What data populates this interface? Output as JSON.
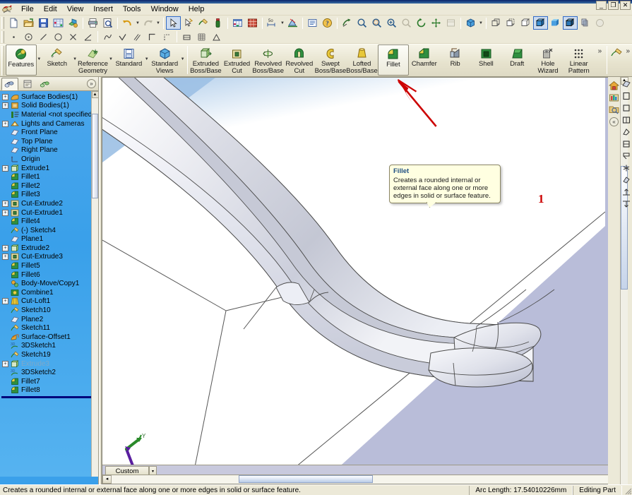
{
  "app": {
    "title": "SolidWorks",
    "logo_icon": "solidworks-logo-icon",
    "minimize_label": "_",
    "restore_label": "❐",
    "close_label": "✕"
  },
  "menubar": {
    "items": [
      {
        "label": "File",
        "name": "menu-file"
      },
      {
        "label": "Edit",
        "name": "menu-edit"
      },
      {
        "label": "View",
        "name": "menu-view"
      },
      {
        "label": "Insert",
        "name": "menu-insert"
      },
      {
        "label": "Tools",
        "name": "menu-tools"
      },
      {
        "label": "Window",
        "name": "menu-window"
      },
      {
        "label": "Help",
        "name": "menu-help"
      }
    ]
  },
  "standard_toolbar": {
    "groups": [
      {
        "buttons": [
          {
            "icon": "new-document-icon",
            "label": "New"
          },
          {
            "icon": "open-folder-icon",
            "label": "Open"
          },
          {
            "icon": "save-icon",
            "label": "Save"
          },
          {
            "icon": "print-preview-grid-icon",
            "label": "Make Drawing from Part"
          },
          {
            "icon": "assembly-icon",
            "label": "Make Assembly from Part"
          }
        ]
      },
      {
        "buttons": [
          {
            "icon": "print-icon",
            "label": "Print"
          },
          {
            "icon": "print-preview-icon",
            "label": "Print Preview"
          }
        ]
      },
      {
        "buttons": [
          {
            "icon": "undo-icon",
            "label": "Undo",
            "dropdown": true
          },
          {
            "icon": "redo-icon",
            "label": "Redo",
            "dropdown": true,
            "disabled": true
          }
        ]
      },
      {
        "buttons": [
          {
            "icon": "select-arrow-icon",
            "label": "Select",
            "framed": true
          },
          {
            "icon": "rebuild-icon",
            "label": "Rebuild"
          },
          {
            "icon": "edit-sketch-icon",
            "label": "Edit Sketch"
          },
          {
            "icon": "toolbox-icon",
            "label": "Toolbox"
          }
        ]
      },
      {
        "buttons": [
          {
            "icon": "options-grid-icon",
            "label": "Options"
          },
          {
            "icon": "red-grid-icon",
            "label": "Customize"
          }
        ]
      },
      {
        "buttons": [
          {
            "icon": "measure-icon",
            "label": "Measure",
            "dropdown": true
          },
          {
            "icon": "section-icon",
            "label": "Section View"
          }
        ]
      },
      {
        "buttons": [
          {
            "icon": "properties-icon",
            "label": "Properties"
          },
          {
            "icon": "help-icon",
            "label": "Help"
          }
        ]
      },
      {
        "buttons": [
          {
            "icon": "previous-view-icon",
            "label": "Previous View"
          },
          {
            "icon": "zoom-to-fit-icon",
            "label": "Zoom to Fit"
          },
          {
            "icon": "zoom-to-area-icon",
            "label": "Zoom to Area"
          },
          {
            "icon": "zoom-in-out-icon",
            "label": "Zoom In/Out"
          },
          {
            "icon": "zoom-to-selection-icon",
            "label": "Zoom to Selection",
            "disabled": true
          },
          {
            "icon": "rotate-view-icon",
            "label": "Rotate View"
          },
          {
            "icon": "pan-icon",
            "label": "Pan"
          },
          {
            "icon": "three-d-drawing-icon",
            "label": "3D Drawing View",
            "disabled": true
          }
        ]
      },
      {
        "buttons": [
          {
            "icon": "view-orientation-icon",
            "label": "View Orientation",
            "dropdown": true
          }
        ]
      },
      {
        "buttons": [
          {
            "icon": "wireframe-icon",
            "label": "Wireframe"
          },
          {
            "icon": "hidden-lines-visible-icon",
            "label": "Hidden Lines Visible"
          },
          {
            "icon": "hidden-lines-removed-icon",
            "label": "Hidden Lines Removed"
          },
          {
            "icon": "shaded-with-edges-icon",
            "label": "Shaded With Edges",
            "framed": true
          },
          {
            "icon": "shaded-icon",
            "label": "Shaded"
          },
          {
            "icon": "display-style-icon",
            "label": "Display Style",
            "framed": true
          },
          {
            "icon": "shadows-icon",
            "label": "Shadows In Shaded Mode"
          },
          {
            "icon": "realview-icon",
            "label": "RealView Graphics",
            "disabled": true
          }
        ]
      }
    ]
  },
  "sketch_toolbar": {
    "buttons": [
      {
        "icon": "point-icon",
        "label": "Point"
      },
      {
        "icon": "circle-icon",
        "label": "Circle"
      },
      {
        "icon": "line-icon",
        "label": "Line"
      },
      {
        "icon": "perimeter-circle-icon",
        "label": "Perimeter Circle"
      },
      {
        "icon": "trim-icon",
        "label": "Trim Entities"
      },
      {
        "icon": "angle-icon",
        "label": "Angle"
      },
      {
        "icon": "spline-icon",
        "label": "Spline"
      },
      {
        "icon": "check-icon",
        "label": "Display/Delete Relations"
      },
      {
        "icon": "offset-entities-icon",
        "label": "Offset Entities"
      },
      {
        "icon": "corner-rectangle-icon",
        "label": "Corner Rectangle"
      },
      {
        "icon": "construction-geometry-icon",
        "label": "Construction Geometry"
      },
      {
        "icon": "rectangular-pattern-icon",
        "label": "Linear Sketch Pattern"
      },
      {
        "icon": "grid-icon",
        "label": "Grid"
      },
      {
        "icon": "mirror-icon",
        "label": "Mirror Entities"
      }
    ]
  },
  "command_manager": {
    "tab_groups": [
      {
        "label": "Features",
        "icon": "features-icon",
        "selected": true,
        "dropdown": true
      },
      {
        "label": "Sketch",
        "icon": "sketch-icon",
        "selected": false,
        "dropdown": true
      },
      {
        "label": "Reference\nGeometry",
        "line1": "Reference",
        "line2": "Geometry",
        "icon": "reference-geometry-icon",
        "dropdown": true
      },
      {
        "label": "Standard",
        "line1": "Standard",
        "line2": "",
        "icon": "standard-icon",
        "dropdown": true
      },
      {
        "label": "Standard Views",
        "line1": "Standard",
        "line2": "Views",
        "icon": "standard-views-icon",
        "dropdown": true
      }
    ],
    "feature_buttons": [
      {
        "line1": "Extruded",
        "line2": "Boss/Base",
        "icon": "extruded-boss-base-icon",
        "selected": false
      },
      {
        "line1": "Extruded",
        "line2": "Cut",
        "icon": "extruded-cut-icon",
        "selected": false
      },
      {
        "line1": "Revolved",
        "line2": "Boss/Base",
        "icon": "revolved-boss-base-icon",
        "selected": false
      },
      {
        "line1": "Revolved",
        "line2": "Cut",
        "icon": "revolved-cut-icon",
        "selected": false
      },
      {
        "line1": "Swept",
        "line2": "Boss/Base",
        "icon": "swept-boss-base-icon",
        "selected": false
      },
      {
        "line1": "Lofted",
        "line2": "Boss/Base",
        "icon": "lofted-boss-base-icon",
        "selected": false
      },
      {
        "line1": "Fillet",
        "line2": "",
        "icon": "fillet-icon",
        "selected": true
      },
      {
        "line1": "Chamfer",
        "line2": "",
        "icon": "chamfer-icon",
        "selected": false
      },
      {
        "line1": "Rib",
        "line2": "",
        "icon": "rib-icon",
        "selected": false
      },
      {
        "line1": "Shell",
        "line2": "",
        "icon": "shell-icon",
        "selected": false
      },
      {
        "line1": "Draft",
        "line2": "",
        "icon": "draft-icon",
        "selected": false
      },
      {
        "line1": "Hole",
        "line2": "Wizard",
        "icon": "hole-wizard-icon",
        "selected": false
      },
      {
        "line1": "Linear",
        "line2": "Pattern",
        "icon": "linear-pattern-icon",
        "selected": false
      }
    ],
    "overflow_label": "»",
    "overflow_label2": "»"
  },
  "tooltip": {
    "title": "Fillet",
    "body": "Creates a rounded internal or external face along one or more edges in solid or surface feature."
  },
  "annotation": {
    "number": "1",
    "color": "#cc0000"
  },
  "panel": {
    "tabs": [
      {
        "name": "feature-manager-tab",
        "icon": "feature-tree-icon",
        "active": true
      },
      {
        "name": "property-manager-tab",
        "icon": "property-manager-icon",
        "active": false
      },
      {
        "name": "configuration-manager-tab",
        "icon": "configuration-manager-icon",
        "active": false
      }
    ],
    "expand_label": "»",
    "tree": [
      {
        "label": "Surface Bodies(1)",
        "icon": "surface-bodies-icon",
        "expandable": true
      },
      {
        "label": "Solid Bodies(1)",
        "icon": "solid-bodies-icon",
        "expandable": true
      },
      {
        "label": "Material <not specified>",
        "icon": "material-icon",
        "expandable": false
      },
      {
        "label": "Lights and Cameras",
        "icon": "lights-cameras-icon",
        "expandable": true
      },
      {
        "label": "Front Plane",
        "icon": "plane-icon",
        "expandable": false
      },
      {
        "label": "Top Plane",
        "icon": "plane-icon",
        "expandable": false
      },
      {
        "label": "Right Plane",
        "icon": "plane-icon",
        "expandable": false
      },
      {
        "label": "Origin",
        "icon": "origin-icon",
        "expandable": false
      },
      {
        "label": "Extrude1",
        "icon": "extrude-icon",
        "expandable": true
      },
      {
        "label": "Fillet1",
        "icon": "fillet-tree-icon",
        "expandable": false
      },
      {
        "label": "Fillet2",
        "icon": "fillet-tree-icon",
        "expandable": false
      },
      {
        "label": "Fillet3",
        "icon": "fillet-tree-icon",
        "expandable": false
      },
      {
        "label": "Cut-Extrude2",
        "icon": "cut-extrude-icon",
        "expandable": true
      },
      {
        "label": "Cut-Extrude1",
        "icon": "cut-extrude-icon",
        "expandable": true
      },
      {
        "label": "Fillet4",
        "icon": "fillet-tree-icon",
        "expandable": false
      },
      {
        "label": "(-) Sketch4",
        "icon": "sketch-tree-icon",
        "expandable": false
      },
      {
        "label": "Plane1",
        "icon": "plane-icon",
        "expandable": false
      },
      {
        "label": "Extrude2",
        "icon": "extrude-icon",
        "expandable": true
      },
      {
        "label": "Cut-Extrude3",
        "icon": "cut-extrude-icon",
        "expandable": true
      },
      {
        "label": "Fillet5",
        "icon": "fillet-tree-icon",
        "expandable": false
      },
      {
        "label": "Fillet6",
        "icon": "fillet-tree-icon",
        "expandable": false
      },
      {
        "label": "Body-Move/Copy1",
        "icon": "body-move-copy-icon",
        "expandable": false
      },
      {
        "label": "Combine1",
        "icon": "combine-icon",
        "expandable": false
      },
      {
        "label": "Cut-Loft1",
        "icon": "cut-loft-icon",
        "expandable": true
      },
      {
        "label": "Sketch10",
        "icon": "sketch-tree-icon",
        "expandable": false
      },
      {
        "label": "Plane2",
        "icon": "plane-icon",
        "expandable": false
      },
      {
        "label": "Sketch11",
        "icon": "sketch-tree-icon",
        "expandable": false
      },
      {
        "label": "Surface-Offset1",
        "icon": "surface-offset-icon",
        "expandable": false
      },
      {
        "label": "3DSketch1",
        "icon": "3d-sketch-icon",
        "expandable": false
      },
      {
        "label": "Sketch19",
        "icon": "sketch-tree-icon",
        "expandable": false
      },
      {
        "label": "Extrude3",
        "icon": "extrude-icon",
        "expandable": true,
        "dimmed": true
      },
      {
        "label": "3DSketch2",
        "icon": "3d-sketch-icon",
        "expandable": false
      },
      {
        "label": "Fillet7",
        "icon": "fillet-tree-icon",
        "expandable": false
      },
      {
        "label": "Fillet8",
        "icon": "fillet-tree-icon",
        "expandable": false
      }
    ]
  },
  "viewport": {
    "background_top": "#b9bdd9",
    "triad": {
      "x_label": "",
      "y_label": "Y",
      "z_label": ""
    },
    "tabs": [
      {
        "label": "Custom",
        "name": "config-tab-custom"
      }
    ],
    "tab_dropdown_label": "▾",
    "scroll_left_label": "◂",
    "scroll_right_label": "▸"
  },
  "right_toolbar": {
    "buttons": [
      {
        "icon": "home-solidworks-resources-icon",
        "label": "SolidWorks Resources"
      },
      {
        "icon": "design-library-icon",
        "label": "Design Library"
      },
      {
        "icon": "file-explorer-icon",
        "label": "File Explorer"
      }
    ],
    "collapse_label": "«",
    "palette": [
      {
        "icon": "view-palette-plane-icon",
        "label": "Plane"
      },
      {
        "icon": "view-palette-front-icon",
        "label": "Front"
      },
      {
        "icon": "view-palette-back-icon",
        "label": "Back"
      },
      {
        "icon": "view-palette-left-icon",
        "label": "Left"
      },
      {
        "icon": "view-palette-right-icon",
        "label": "Right"
      },
      {
        "icon": "view-palette-top-icon",
        "label": "Top"
      },
      {
        "icon": "view-palette-bottom-icon",
        "label": "Bottom"
      },
      {
        "icon": "view-palette-iso-icon",
        "label": "Isometric"
      },
      {
        "icon": "view-palette-trimetric-icon",
        "label": "Trimetric"
      },
      {
        "icon": "view-palette-dimetric-icon",
        "label": "Dimetric"
      },
      {
        "icon": "view-palette-normal-icon",
        "label": "Normal To"
      }
    ]
  },
  "statusbar": {
    "message": "Creates a rounded internal or external face along one or more edges in solid or surface feature.",
    "arc_length": "Arc Length: 17.54010226mm",
    "edit_mode": "Editing Part"
  }
}
